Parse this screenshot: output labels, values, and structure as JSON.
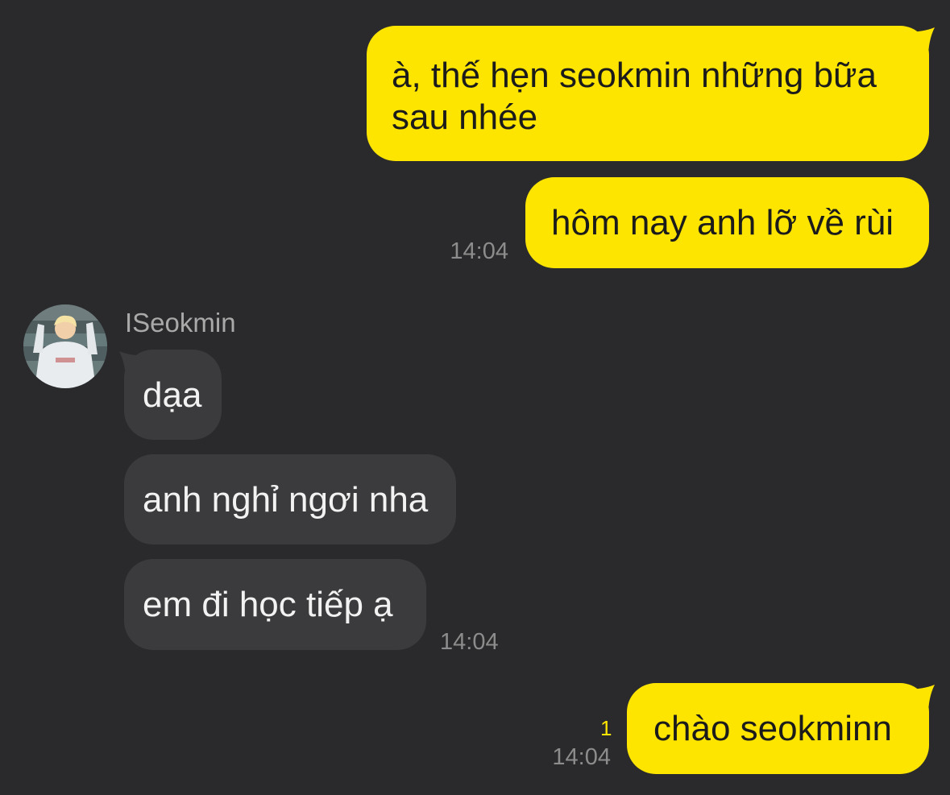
{
  "chat": {
    "contact_name": "ISeokmin",
    "contact_avatar_icon": "profile-photo",
    "colors": {
      "background": "#2a2a2c",
      "outgoing_bubble": "#fee500",
      "incoming_bubble": "#3b3b3d",
      "unread_count": "#fee500",
      "timestamp": "#8c8c8c"
    },
    "messages": [
      {
        "direction": "outgoing",
        "line1": "à, thế hẹn seokmin những bữa",
        "line2": "sau nhée"
      },
      {
        "direction": "outgoing",
        "text": "hôm nay anh lỡ về rùi",
        "time": "14:04"
      },
      {
        "direction": "incoming",
        "text": "dạa"
      },
      {
        "direction": "incoming",
        "text": "anh nghỉ ngơi nha"
      },
      {
        "direction": "incoming",
        "text": "em đi học tiếp ạ",
        "time": "14:04"
      },
      {
        "direction": "outgoing",
        "text": "chào seokminn",
        "time": "14:04",
        "unread": "1"
      }
    ]
  }
}
